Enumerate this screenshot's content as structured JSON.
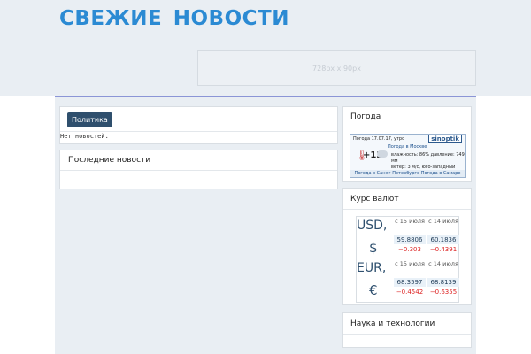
{
  "header": {
    "site_title": "СВЕЖИЕ  НОВОСТИ",
    "ad_placeholder": "728px х 90px"
  },
  "category_box": {
    "button_label": "Политика",
    "empty_text": "Нет новостей."
  },
  "latest_news": {
    "title": "Последние новости"
  },
  "weather": {
    "title": "Погода",
    "widget": {
      "header": "Погода 17.07.17, утро",
      "logo": "sinoptik",
      "city": "Погода в Москве",
      "temperature": "+12°",
      "humidity": "влажность: 86% давление: 749 мм",
      "wind": "ветер: 3 м/с, юго-западный",
      "footer": "Погода в Санкт-Петербурге  Погода в Самаре"
    }
  },
  "currency": {
    "title": "Курс валют",
    "date_header_1": "с 15 июля",
    "date_header_2": "с 14 июля",
    "rows": [
      {
        "code": "USD,",
        "symbol": "$",
        "val_1": "59.8806",
        "val_2": "60.1836",
        "diff_1": "−0.303",
        "diff_2": "−0.4391"
      },
      {
        "code": "EUR,",
        "symbol": "€",
        "val_1": "68.3597",
        "val_2": "68.8139",
        "diff_1": "−0.4542",
        "diff_2": "−0.6355"
      }
    ]
  },
  "science": {
    "title": "Наука и технологии"
  },
  "colors": {
    "accent": "#2b8ad3",
    "header_bg": "#e9eef3",
    "button_bg": "#2f4f6d",
    "negative": "#dd2222"
  }
}
